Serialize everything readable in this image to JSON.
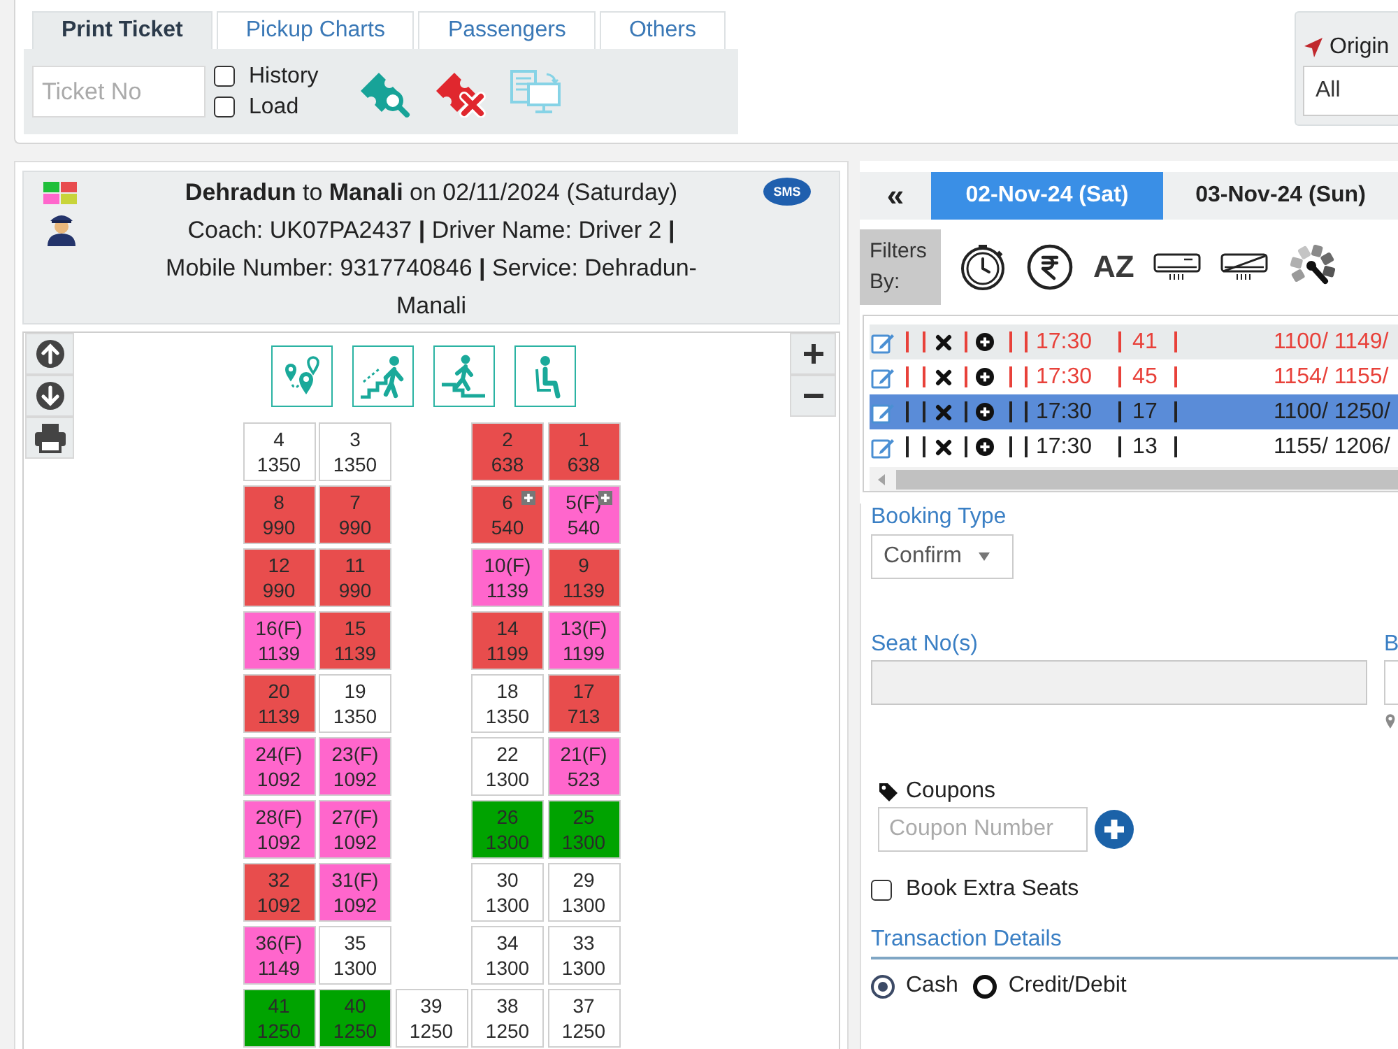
{
  "top_tabs": [
    {
      "label": "Print Ticket",
      "selected": true
    },
    {
      "label": "Pickup Charts",
      "selected": false
    },
    {
      "label": "Passengers",
      "selected": false
    },
    {
      "label": "Others",
      "selected": false
    }
  ],
  "ticket_lookup": {
    "placeholder": "Ticket No",
    "options": [
      {
        "label": "History",
        "checked": false
      },
      {
        "label": "Load",
        "checked": false
      }
    ]
  },
  "origin": {
    "label": "Origin",
    "value": "All"
  },
  "trip_header": {
    "title": "**Dehradun** to **Manali** on 02/11/2024 (Saturday)",
    "details": "Coach: UK07PA2437 **|** Driver Name: Driver 2 **|** Mobile Number: 9317740846 **|** Service: Dehradun-Manali",
    "sms": "SMS"
  },
  "seat_rows": [
    {
      "left": [
        {
          "number": "4",
          "fare": "1350",
          "color": "#ffffff",
          "extra": false
        },
        {
          "number": "3",
          "fare": "1350",
          "color": "#ffffff",
          "extra": false
        }
      ],
      "right": [
        {
          "number": "2",
          "fare": "638",
          "color": "#e84d4d",
          "extra": false
        },
        {
          "number": "1",
          "fare": "638",
          "color": "#e84d4d",
          "extra": false
        }
      ]
    },
    {
      "left": [
        {
          "number": "8",
          "fare": "990",
          "color": "#e84d4d",
          "extra": false
        },
        {
          "number": "7",
          "fare": "990",
          "color": "#e84d4d",
          "extra": false
        }
      ],
      "right": [
        {
          "number": "6",
          "fare": "540",
          "color": "#e84d4d",
          "extra": true
        },
        {
          "number": "5(F)",
          "fare": "540",
          "color": "#ff66cc",
          "extra": true
        }
      ]
    },
    {
      "left": [
        {
          "number": "12",
          "fare": "990",
          "color": "#e84d4d",
          "extra": false
        },
        {
          "number": "11",
          "fare": "990",
          "color": "#e84d4d",
          "extra": false
        }
      ],
      "right": [
        {
          "number": "10(F)",
          "fare": "1139",
          "color": "#ff66cc",
          "extra": false
        },
        {
          "number": "9",
          "fare": "1139",
          "color": "#e84d4d",
          "extra": false
        }
      ]
    },
    {
      "left": [
        {
          "number": "16(F)",
          "fare": "1139",
          "color": "#ff66cc",
          "extra": false
        },
        {
          "number": "15",
          "fare": "1139",
          "color": "#e84d4d",
          "extra": false
        }
      ],
      "right": [
        {
          "number": "14",
          "fare": "1199",
          "color": "#e84d4d",
          "extra": false
        },
        {
          "number": "13(F)",
          "fare": "1199",
          "color": "#ff66cc",
          "extra": false
        }
      ]
    },
    {
      "left": [
        {
          "number": "20",
          "fare": "1139",
          "color": "#e84d4d",
          "extra": false
        },
        {
          "number": "19",
          "fare": "1350",
          "color": "#ffffff",
          "extra": false
        }
      ],
      "right": [
        {
          "number": "18",
          "fare": "1350",
          "color": "#ffffff",
          "extra": false
        },
        {
          "number": "17",
          "fare": "713",
          "color": "#e84d4d",
          "extra": false
        }
      ]
    },
    {
      "left": [
        {
          "number": "24(F)",
          "fare": "1092",
          "color": "#ff66cc",
          "extra": false
        },
        {
          "number": "23(F)",
          "fare": "1092",
          "color": "#ff66cc",
          "extra": false
        }
      ],
      "right": [
        {
          "number": "22",
          "fare": "1300",
          "color": "#ffffff",
          "extra": false
        },
        {
          "number": "21(F)",
          "fare": "523",
          "color": "#ff66cc",
          "extra": false
        }
      ]
    },
    {
      "left": [
        {
          "number": "28(F)",
          "fare": "1092",
          "color": "#ff66cc",
          "extra": false
        },
        {
          "number": "27(F)",
          "fare": "1092",
          "color": "#ff66cc",
          "extra": false
        }
      ],
      "right": [
        {
          "number": "26",
          "fare": "1300",
          "color": "#00a300",
          "extra": false
        },
        {
          "number": "25",
          "fare": "1300",
          "color": "#00a300",
          "extra": false
        }
      ]
    },
    {
      "left": [
        {
          "number": "32",
          "fare": "1092",
          "color": "#e84d4d",
          "extra": false
        },
        {
          "number": "31(F)",
          "fare": "1092",
          "color": "#ff66cc",
          "extra": false
        }
      ],
      "right": [
        {
          "number": "30",
          "fare": "1300",
          "color": "#ffffff",
          "extra": false
        },
        {
          "number": "29",
          "fare": "1300",
          "color": "#ffffff",
          "extra": false
        }
      ]
    },
    {
      "left": [
        {
          "number": "36(F)",
          "fare": "1149",
          "color": "#ff66cc",
          "extra": false
        },
        {
          "number": "35",
          "fare": "1300",
          "color": "#ffffff",
          "extra": false
        }
      ],
      "right": [
        {
          "number": "34",
          "fare": "1300",
          "color": "#ffffff",
          "extra": false
        },
        {
          "number": "33",
          "fare": "1300",
          "color": "#ffffff",
          "extra": false
        }
      ]
    },
    {
      "left": [
        {
          "number": "41",
          "fare": "1250",
          "color": "#00a300",
          "extra": false
        },
        {
          "number": "40",
          "fare": "1250",
          "color": "#00a300",
          "extra": false
        }
      ],
      "aisle": [
        {
          "number": "39",
          "fare": "1250",
          "color": "#ffffff",
          "extra": false
        }
      ],
      "right": [
        {
          "number": "38",
          "fare": "1250",
          "color": "#ffffff",
          "extra": false
        },
        {
          "number": "37",
          "fare": "1250",
          "color": "#ffffff",
          "extra": false
        }
      ]
    }
  ],
  "dates": {
    "back": "«",
    "items": [
      {
        "label": "02-Nov-24 (Sat)",
        "selected": true
      },
      {
        "label": "03-Nov-24 (Sun)",
        "selected": false
      }
    ]
  },
  "filters": {
    "label": "Filters By:",
    "sort_label": "AZ"
  },
  "trips": [
    {
      "time": "17:30",
      "seats": "41",
      "fares": "1100/ 1149/",
      "color": "#e8413a",
      "selected": false,
      "highlighted": true
    },
    {
      "time": "17:30",
      "seats": "45",
      "fares": "1154/ 1155/",
      "color": "#e8413a",
      "selected": false,
      "highlighted": false
    },
    {
      "time": "17:30",
      "seats": "17",
      "fares": "1100/ 1250/",
      "color": "#222222",
      "selected": true,
      "highlighted": false
    },
    {
      "time": "17:30",
      "seats": "13",
      "fares": "1155/ 1206/",
      "color": "#222222",
      "selected": false,
      "highlighted": false
    }
  ],
  "booking": {
    "booking_type": {
      "label": "Booking Type",
      "value": "Confirm"
    },
    "seat_numbers": {
      "label": "Seat No(s)"
    },
    "next_field": {
      "label": "B"
    },
    "coupons": {
      "label": "Coupons",
      "placeholder": "Coupon Number"
    },
    "extra_seats": {
      "label": "Book Extra Seats",
      "checked": false
    },
    "transaction": {
      "title": "Transaction Details",
      "methods": [
        {
          "label": "Cash",
          "selected": true
        },
        {
          "label": "Credit/Debit",
          "selected": false
        }
      ]
    }
  }
}
